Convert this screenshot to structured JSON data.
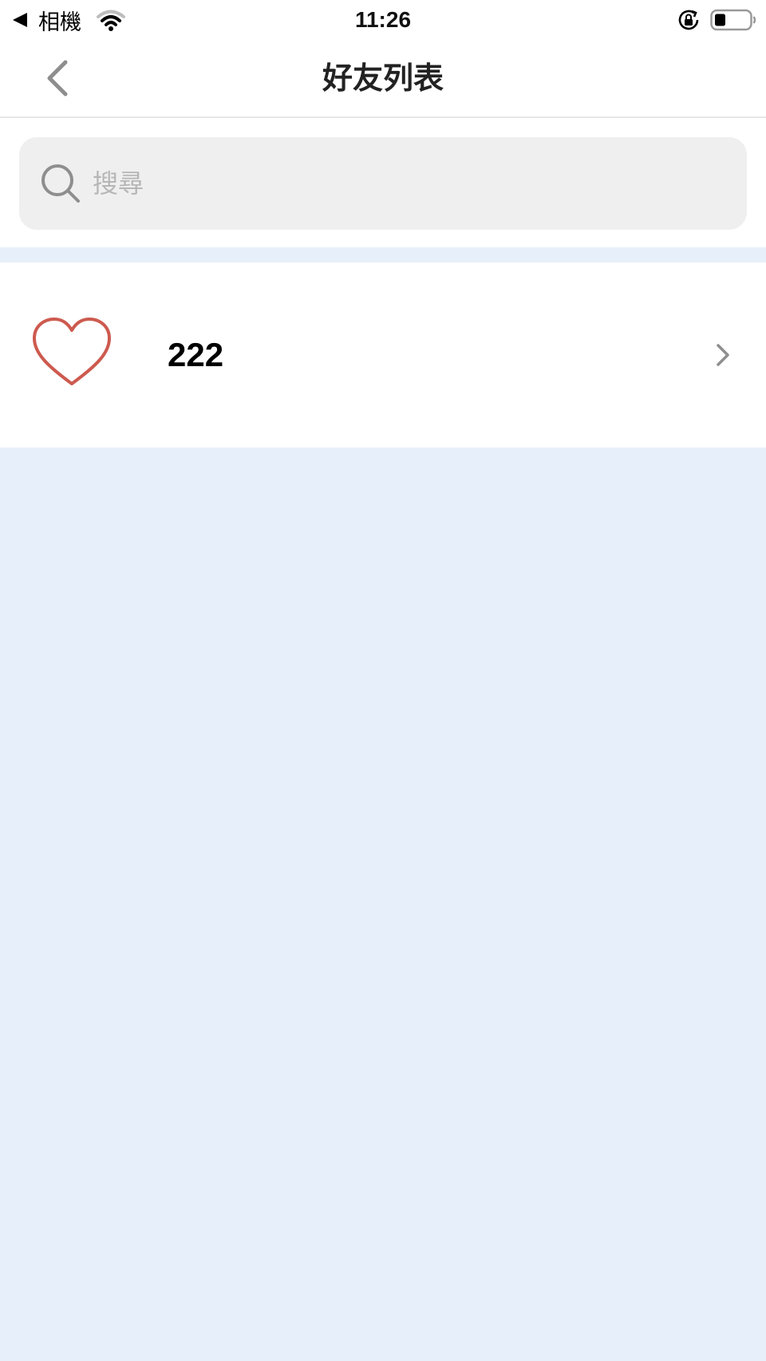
{
  "status_bar": {
    "back_app_label": "相機",
    "time": "11:26",
    "icons": [
      "back-triangle-icon",
      "wifi-icon",
      "rotation-lock-icon",
      "battery-icon"
    ]
  },
  "nav": {
    "title": "好友列表",
    "back_icon": "chevron-left-icon"
  },
  "search": {
    "placeholder": "搜尋",
    "value": "",
    "icon": "search-icon"
  },
  "friends": [
    {
      "name": "222",
      "avatar_icon": "heart-icon",
      "accessory_icon": "chevron-right-icon"
    }
  ],
  "colors": {
    "background": "#e7f0fa",
    "surface": "#ffffff",
    "search_box": "#efefef",
    "avatar_heart": "#cd5a4f",
    "icon_gray": "#8e8e8e"
  }
}
